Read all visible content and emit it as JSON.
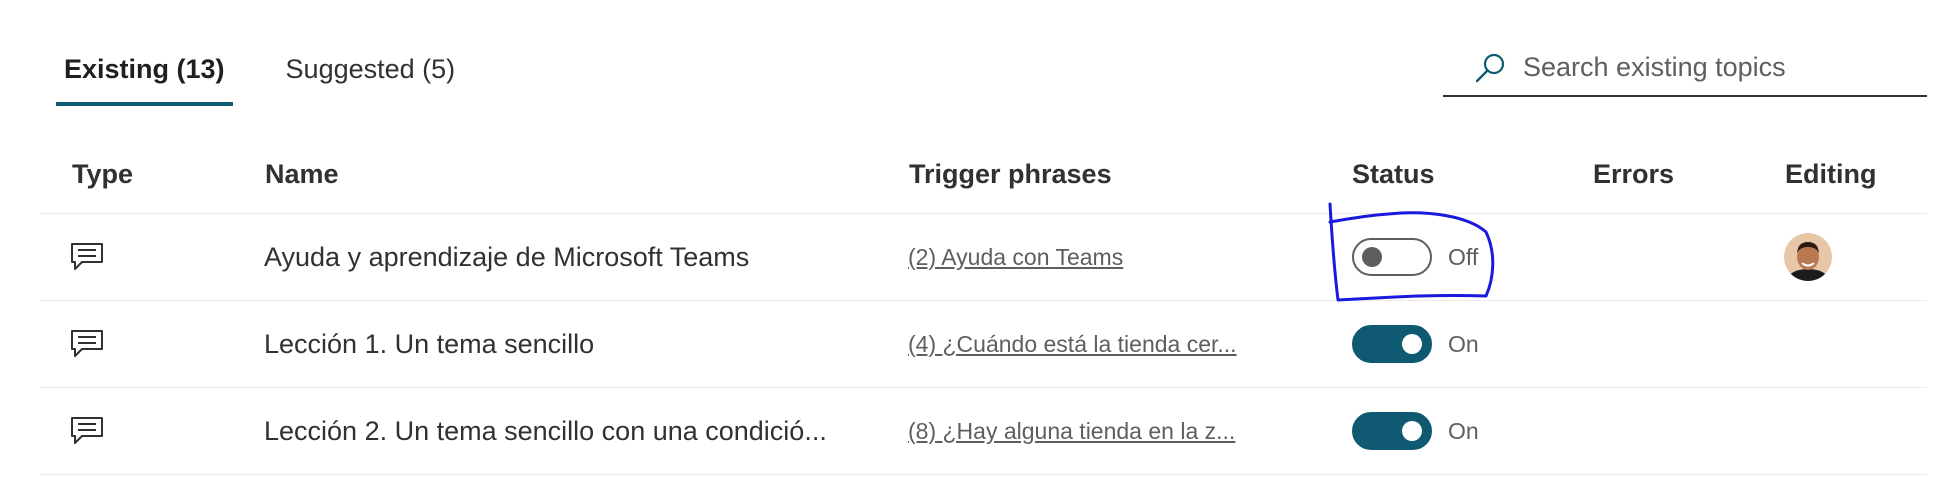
{
  "tabs": [
    {
      "label": "Existing (13)",
      "active": true
    },
    {
      "label": "Suggested (5)",
      "active": false
    }
  ],
  "search": {
    "placeholder": "Search existing topics",
    "icon": "search-icon"
  },
  "table": {
    "headers": {
      "type": "Type",
      "name": "Name",
      "trigger": "Trigger phrases",
      "status": "Status",
      "errors": "Errors",
      "editing": "Editing"
    },
    "rows": [
      {
        "type_icon": "chat-message-icon",
        "name": "Ayuda y aprendizaje de Microsoft Teams",
        "trigger": "(2) Ayuda con Teams",
        "status": "Off",
        "status_on": false,
        "errors": "",
        "editing_avatar": true
      },
      {
        "type_icon": "chat-message-icon",
        "name": "Lección 1. Un tema sencillo",
        "trigger": "(4) ¿Cuándo está la tienda cer...",
        "status": "On",
        "status_on": true,
        "errors": "",
        "editing_avatar": false
      },
      {
        "type_icon": "chat-message-icon",
        "name": "Lección 2. Un tema sencillo con una condició...",
        "trigger": "(8) ¿Hay alguna tienda en la z...",
        "status": "On",
        "status_on": true,
        "errors": "",
        "editing_avatar": false
      }
    ]
  },
  "colors": {
    "accent": "#0f5a72",
    "annotation": "#1a1adf",
    "text": "#323130",
    "muted": "#605e5c",
    "divider": "#edebe9"
  }
}
